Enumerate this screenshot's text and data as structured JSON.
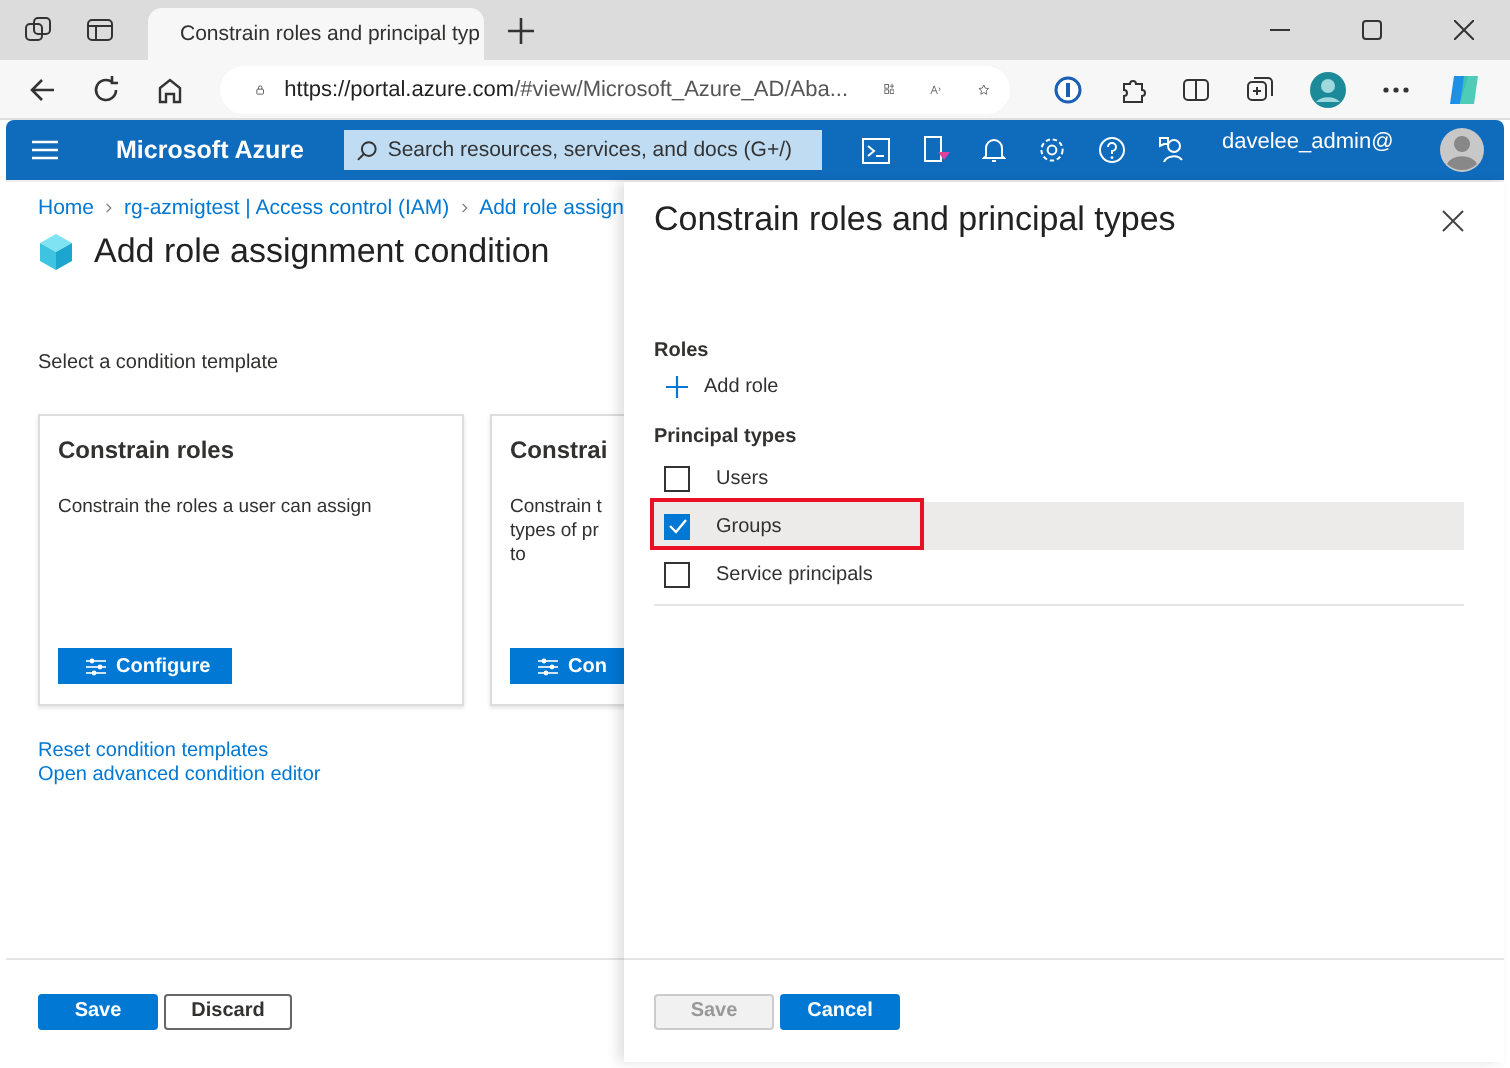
{
  "browser": {
    "tabs": [
      {
        "title": "Constrain roles and principal typ",
        "selected": true
      }
    ],
    "url_host": "https://portal.azure.com",
    "url_path": "/#view/Microsoft_Azure_AD/Aba..."
  },
  "portal": {
    "brand": "Microsoft Azure",
    "search": {
      "placeholder": "Search resources, services, and docs (G+/)"
    },
    "user": "davelee_admin@"
  },
  "breadcrumb": [
    "Home",
    "rg-azmigtest | Access control (IAM)",
    "Add role assign"
  ],
  "page": {
    "title": "Add role assignment condition",
    "subtitle": "Select a condition template",
    "templates": [
      {
        "title": "Constrain roles",
        "description": [
          "Constrain the roles a user can assign"
        ],
        "button": "Configure"
      },
      {
        "title": "Constrai",
        "description": [
          "Constrain t",
          "types of pr",
          "to"
        ],
        "button": "Con"
      }
    ],
    "links": [
      "Reset condition templates",
      "Open advanced condition editor"
    ],
    "buttons": [
      {
        "label": "Save",
        "kind": "primary",
        "disabled": false
      },
      {
        "label": "Discard",
        "kind": "secondary",
        "disabled": false
      }
    ]
  },
  "panel": {
    "title": "Constrain roles and principal types",
    "roles_label": "Roles",
    "add_role": "Add role",
    "principal_label": "Principal types",
    "principal_types": [
      {
        "label": "Users",
        "checked": false,
        "selected": false,
        "highlighted": false
      },
      {
        "label": "Groups",
        "checked": true,
        "selected": true,
        "highlighted": true
      },
      {
        "label": "Service principals",
        "checked": false,
        "selected": false,
        "highlighted": false
      }
    ],
    "buttons": [
      {
        "label": "Save",
        "kind": "primary",
        "disabled": true
      },
      {
        "label": "Cancel",
        "kind": "primary",
        "disabled": false
      }
    ]
  }
}
